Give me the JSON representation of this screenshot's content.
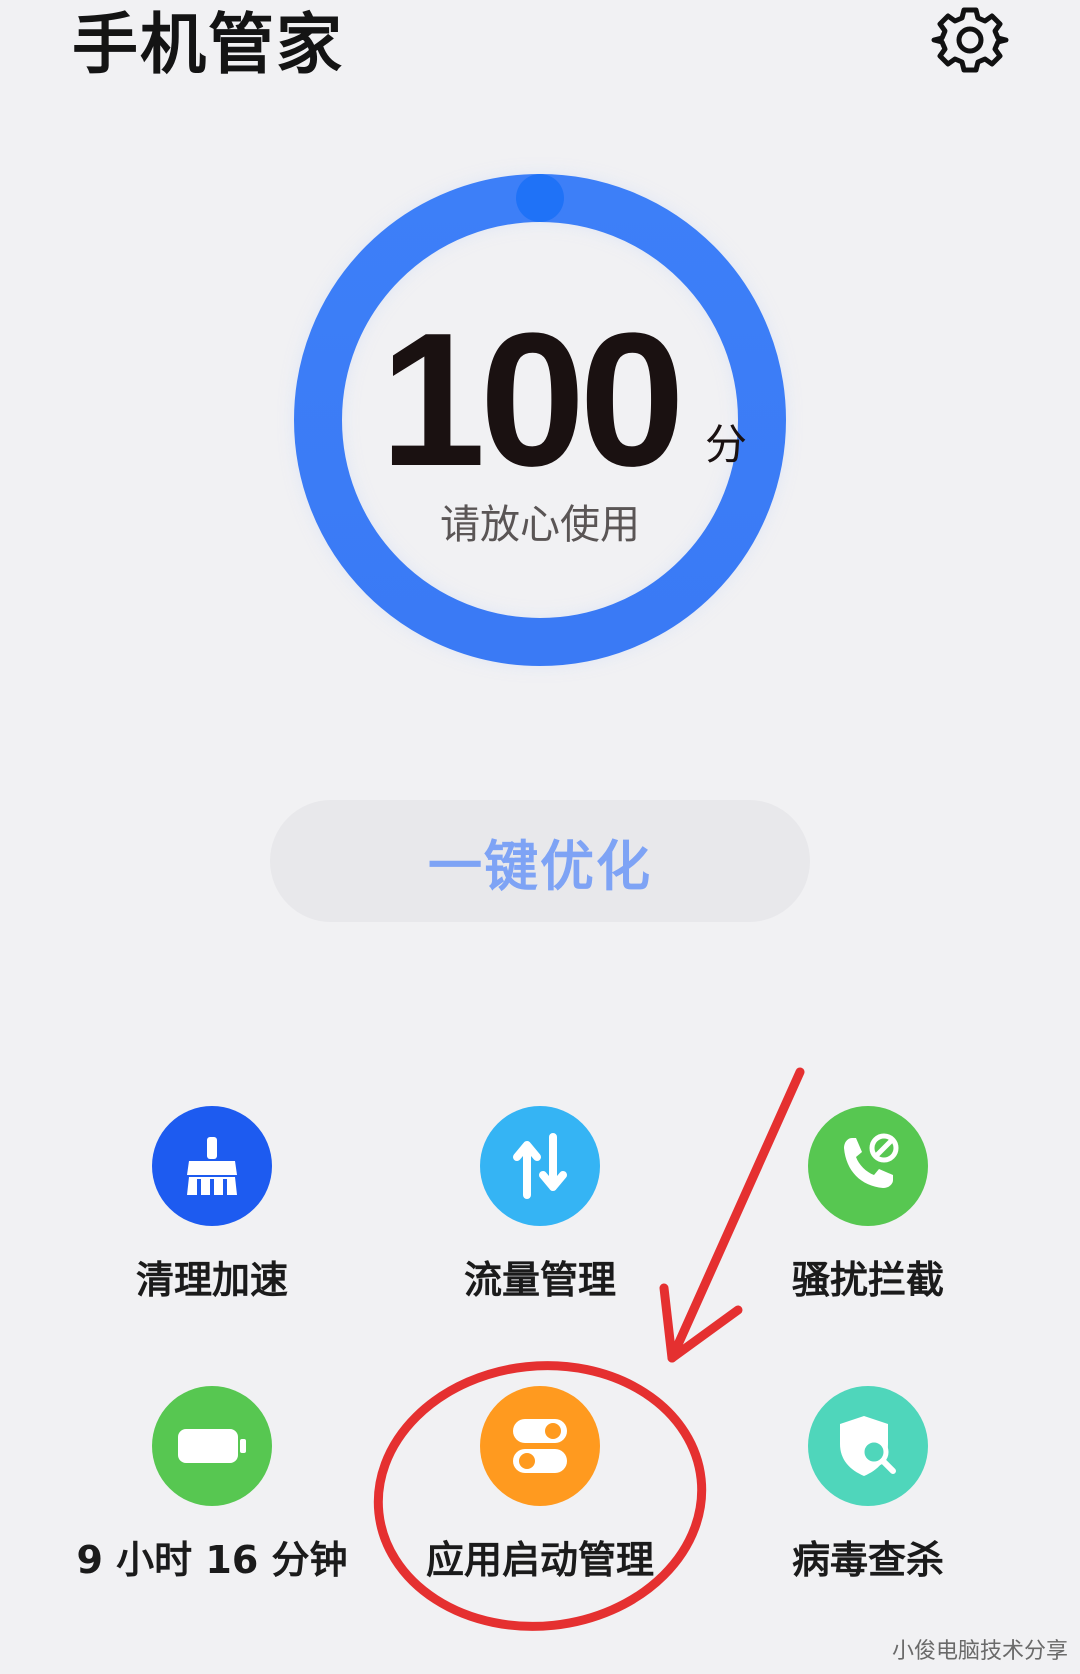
{
  "header": {
    "title": "手机管家",
    "settings_icon": "gear-icon"
  },
  "score": {
    "value": "100",
    "unit": "分",
    "status": "请放心使用",
    "ring_color": "#3b7bf6",
    "progress": 1.0
  },
  "optimize_button": {
    "label": "一键优化",
    "color": "#7ea3f5"
  },
  "tools": [
    {
      "label": "清理加速",
      "icon": "broom-icon",
      "color": "#1d5bf0"
    },
    {
      "label": "流量管理",
      "icon": "data-transfer-icon",
      "color": "#35b4f4"
    },
    {
      "label": "骚扰拦截",
      "icon": "blocked-call-icon",
      "color": "#57c751"
    },
    {
      "label": "9 小时 16 分钟",
      "icon": "battery-icon",
      "color": "#57c751"
    },
    {
      "label": "应用启动管理",
      "icon": "toggle-switch-icon",
      "color": "#ff9a1f"
    },
    {
      "label": "病毒查杀",
      "icon": "shield-search-icon",
      "color": "#4fd6bb"
    }
  ],
  "annotation": {
    "color": "#e53030"
  },
  "watermark": "小俊电脑技术分享"
}
